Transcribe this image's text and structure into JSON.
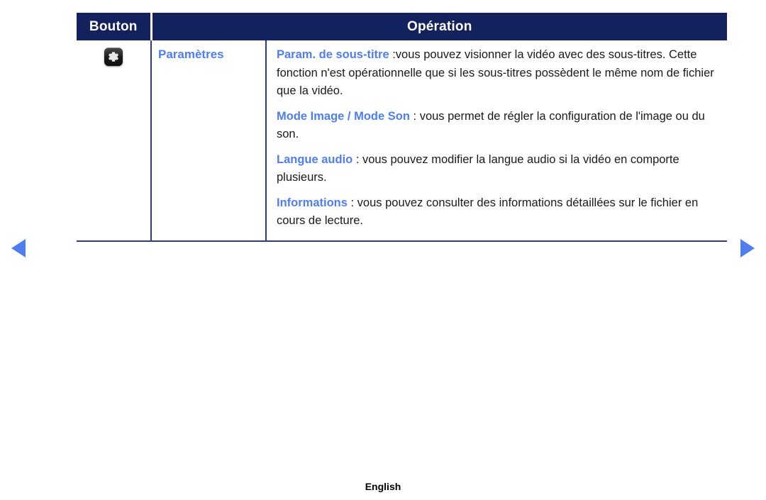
{
  "table": {
    "headers": {
      "button": "Bouton",
      "operation": "Opération"
    },
    "row": {
      "icon_name": "settings-gear-icon",
      "label": "Paramètres",
      "paragraphs": [
        {
          "key": "Param. de sous-titre",
          "text": " :vous pouvez visionner la vidéo avec des sous-titres. Cette fonction n'est opérationnelle que si les sous-titres possèdent le même nom de fichier que la vidéo."
        },
        {
          "key": "Mode Image / Mode Son",
          "text": " : vous permet de régler la configuration de l'image ou du son."
        },
        {
          "key": "Langue audio",
          "text": " : vous pouvez modifier la langue audio si la vidéo en comporte plusieurs."
        },
        {
          "key": "Informations",
          "text": " : vous pouvez consulter des informations détaillées sur le fichier en cours de lecture."
        }
      ]
    }
  },
  "navigation": {
    "prev_icon": "triangle-left-icon",
    "next_icon": "triangle-right-icon"
  },
  "footer": {
    "language": "English"
  },
  "colors": {
    "header_navy": "#13225f",
    "accent_blue": "#4f7ef0",
    "border_blue": "#2b3a8c",
    "body_text": "#1a1a1a"
  }
}
